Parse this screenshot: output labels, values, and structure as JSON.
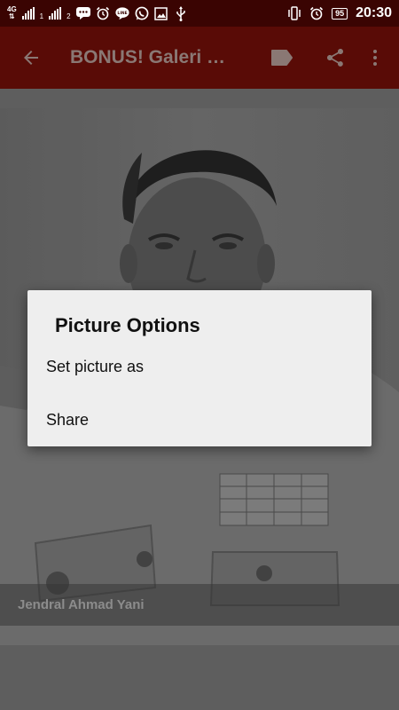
{
  "status_bar": {
    "network": "4G",
    "sim1": "1",
    "sim2": "2",
    "battery": "95",
    "time": "20:30"
  },
  "toolbar": {
    "title": "BONUS! Galeri Pahlawan",
    "back_icon": "arrow-back-icon",
    "label_icon": "label-icon",
    "share_icon": "share-icon",
    "more_icon": "more-vert-icon"
  },
  "photo": {
    "caption": "Jendral Ahmad Yani"
  },
  "dialog": {
    "title": "Picture Options",
    "items": [
      "Set picture as",
      "Share"
    ]
  },
  "colors": {
    "toolbar": "#590b06",
    "status_bar": "#3a0402",
    "dialog_bg": "#eeeeee",
    "scrim": "#5e5e5e"
  }
}
